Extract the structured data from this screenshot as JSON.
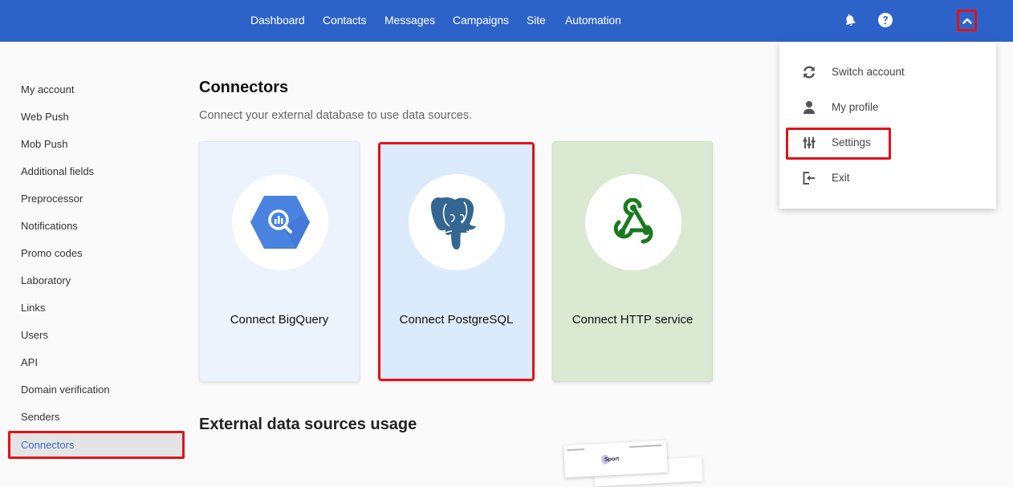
{
  "topbar": {
    "background": "#2d63c8",
    "nav": [
      {
        "label": "Dashboard"
      },
      {
        "label": "Contacts"
      },
      {
        "label": "Messages"
      },
      {
        "label": "Campaigns"
      },
      {
        "label": "Site"
      },
      {
        "label": "Automation"
      }
    ],
    "icons": {
      "notifications": "bell-icon",
      "help": "question-circle-icon",
      "account_menu_toggle": "chevron-up-icon"
    }
  },
  "sidebar": {
    "items": [
      {
        "label": "My account"
      },
      {
        "label": "Web Push"
      },
      {
        "label": "Mob Push"
      },
      {
        "label": "Additional fields"
      },
      {
        "label": "Preprocessor"
      },
      {
        "label": "Notifications"
      },
      {
        "label": "Promo codes"
      },
      {
        "label": "Laboratory"
      },
      {
        "label": "Links"
      },
      {
        "label": "Users"
      },
      {
        "label": "API"
      },
      {
        "label": "Domain verification"
      },
      {
        "label": "Senders"
      },
      {
        "label": "Connectors",
        "active": true
      }
    ],
    "active_color": "#3d6ec7"
  },
  "main": {
    "title": "Connectors",
    "subtitle": "Connect your external database to use data sources.",
    "cards": [
      {
        "label": "Connect BigQuery",
        "icon": "bigquery-icon",
        "background": "#edf3fd"
      },
      {
        "label": "Connect PostgreSQL",
        "icon": "postgresql-elephant-icon",
        "background": "#dcebfb"
      },
      {
        "label": "Connect HTTP service",
        "icon": "webhook-icon",
        "background": "#dbe9d3"
      }
    ],
    "section_title": "External data sources usage",
    "preview": {
      "brand": "Sport"
    }
  },
  "account_menu": {
    "items": [
      {
        "label": "Switch account",
        "icon": "sync-icon"
      },
      {
        "label": "My profile",
        "icon": "user-icon"
      },
      {
        "label": "Settings",
        "icon": "sliders-icon"
      },
      {
        "label": "Exit",
        "icon": "sign-out-icon"
      }
    ]
  },
  "highlight_color": "#e0121b"
}
